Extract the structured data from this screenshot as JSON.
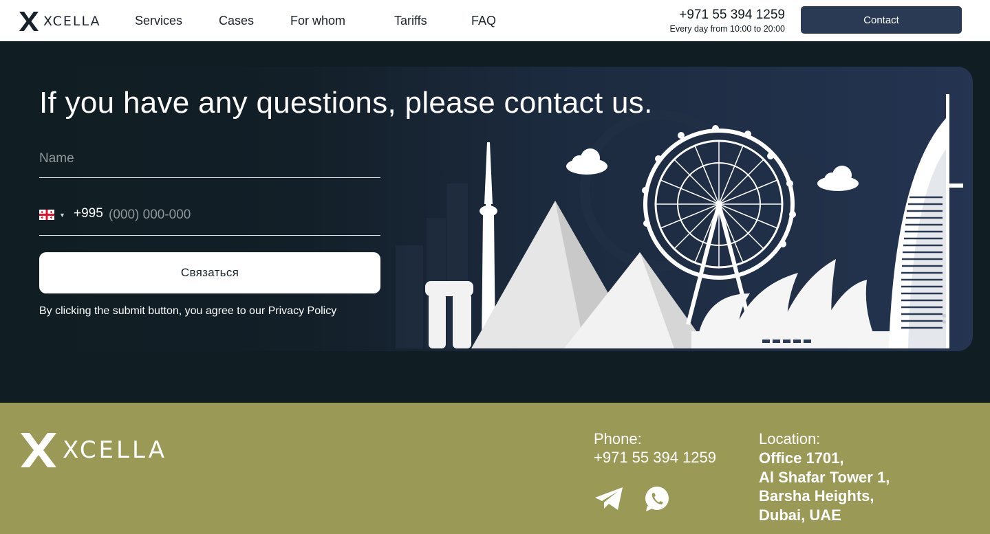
{
  "header": {
    "brand": "XCELLA",
    "nav": [
      {
        "label": "Services"
      },
      {
        "label": "Cases"
      },
      {
        "label": "For whom"
      },
      {
        "label": "Tariffs"
      },
      {
        "label": "FAQ"
      }
    ],
    "phone": "+971 55 394 1259",
    "hours": "Every day from 10:00 to 20:00",
    "contact_button": "Contact"
  },
  "contact": {
    "title": "If you have any questions, please contact us.",
    "name_placeholder": "Name",
    "phone_country_flag": "georgia-flag-icon",
    "phone_code": "+995",
    "phone_placeholder": "(000) 000-000",
    "submit_label": "Связаться",
    "consent_prefix": "By clicking the submit button, you agree to our ",
    "consent_link": "Privacy Policy"
  },
  "footer": {
    "brand": "XCELLA",
    "phone_label": "Phone:",
    "phone": "+971 55 394 1259",
    "social": [
      {
        "icon": "telegram-icon"
      },
      {
        "icon": "whatsapp-icon"
      }
    ],
    "location_label": "Location:",
    "location_lines": [
      "Office 1701,",
      "Al Shafar Tower 1,",
      "Barsha Heights,",
      "Dubai, UAE"
    ]
  },
  "colors": {
    "header_bg": "#ffffff",
    "section_bg": "#101d22",
    "card_accent": "#243451",
    "contact_button": "#2a3a55",
    "footer_bg": "#9a9a56"
  }
}
